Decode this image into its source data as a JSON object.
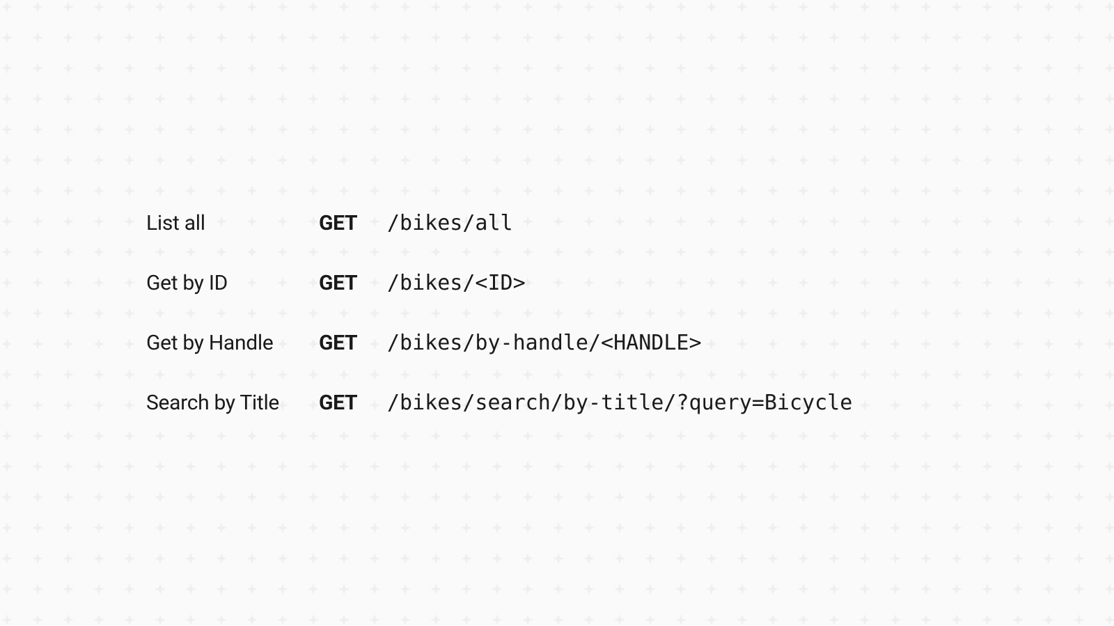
{
  "endpoints": [
    {
      "label": "List all",
      "method": "GET",
      "path": "/bikes/all"
    },
    {
      "label": "Get by ID",
      "method": "GET",
      "path": "/bikes/<ID>"
    },
    {
      "label": "Get by Handle",
      "method": "GET",
      "path": "/bikes/by-handle/<HANDLE>"
    },
    {
      "label": "Search by Title",
      "method": "GET",
      "path": "/bikes/search/by-title/?query=Bicycle"
    }
  ]
}
